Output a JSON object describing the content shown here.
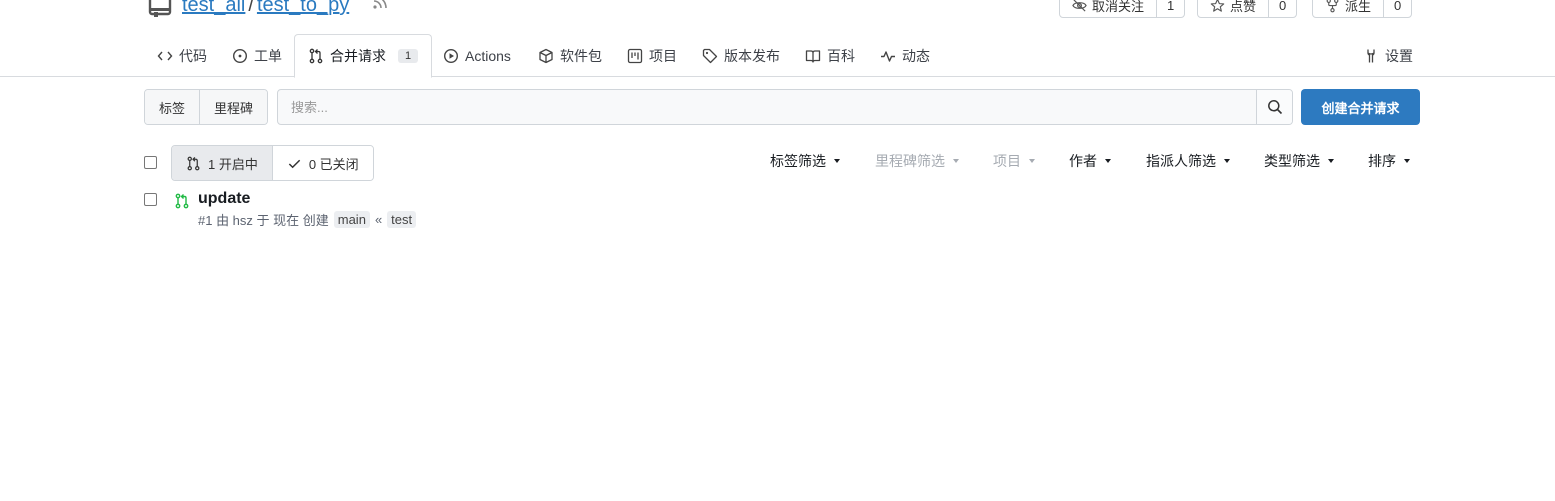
{
  "repo": {
    "owner": "test_all",
    "separator": "/",
    "name": "test_to_py",
    "watch": {
      "label": "取消关注",
      "count": "1"
    },
    "star": {
      "label": "点赞",
      "count": "0"
    },
    "fork": {
      "label": "派生",
      "count": "0"
    }
  },
  "tabs": [
    {
      "label": "代码",
      "icon": "code-icon"
    },
    {
      "label": "工单",
      "icon": "issue-icon"
    },
    {
      "label": "合并请求",
      "icon": "pull-request-icon",
      "badge": "1",
      "active": true
    },
    {
      "label": "Actions",
      "icon": "play-icon"
    },
    {
      "label": "软件包",
      "icon": "package-icon"
    },
    {
      "label": "项目",
      "icon": "project-icon"
    },
    {
      "label": "版本发布",
      "icon": "tag-icon"
    },
    {
      "label": "百科",
      "icon": "book-icon"
    },
    {
      "label": "动态",
      "icon": "pulse-icon"
    }
  ],
  "settings_tab": {
    "label": "设置",
    "icon": "tools-icon"
  },
  "toolbar": {
    "labels_button": "标签",
    "milestones_button": "里程碑",
    "search_placeholder": "搜索...",
    "new_pr_button": "创建合并请求"
  },
  "state": {
    "open_label": "1 开启中",
    "closed_label": "0 已关闭"
  },
  "filters": [
    {
      "label": "标签筛选",
      "disabled": false
    },
    {
      "label": "里程碑筛选",
      "disabled": true
    },
    {
      "label": "项目",
      "disabled": true
    },
    {
      "label": "作者",
      "disabled": false
    },
    {
      "label": "指派人筛选",
      "disabled": false
    },
    {
      "label": "类型筛选",
      "disabled": false
    },
    {
      "label": "排序",
      "disabled": false
    }
  ],
  "pull_requests": [
    {
      "title": "update",
      "meta": "#1 由 hsz 于 现在 创建",
      "base_branch": "main",
      "arrow": "«",
      "head_branch": "test"
    }
  ],
  "colors": {
    "link": "#2a7ac0",
    "primary_button": "#2d7ac0",
    "open_state_green": "#21ba45"
  }
}
